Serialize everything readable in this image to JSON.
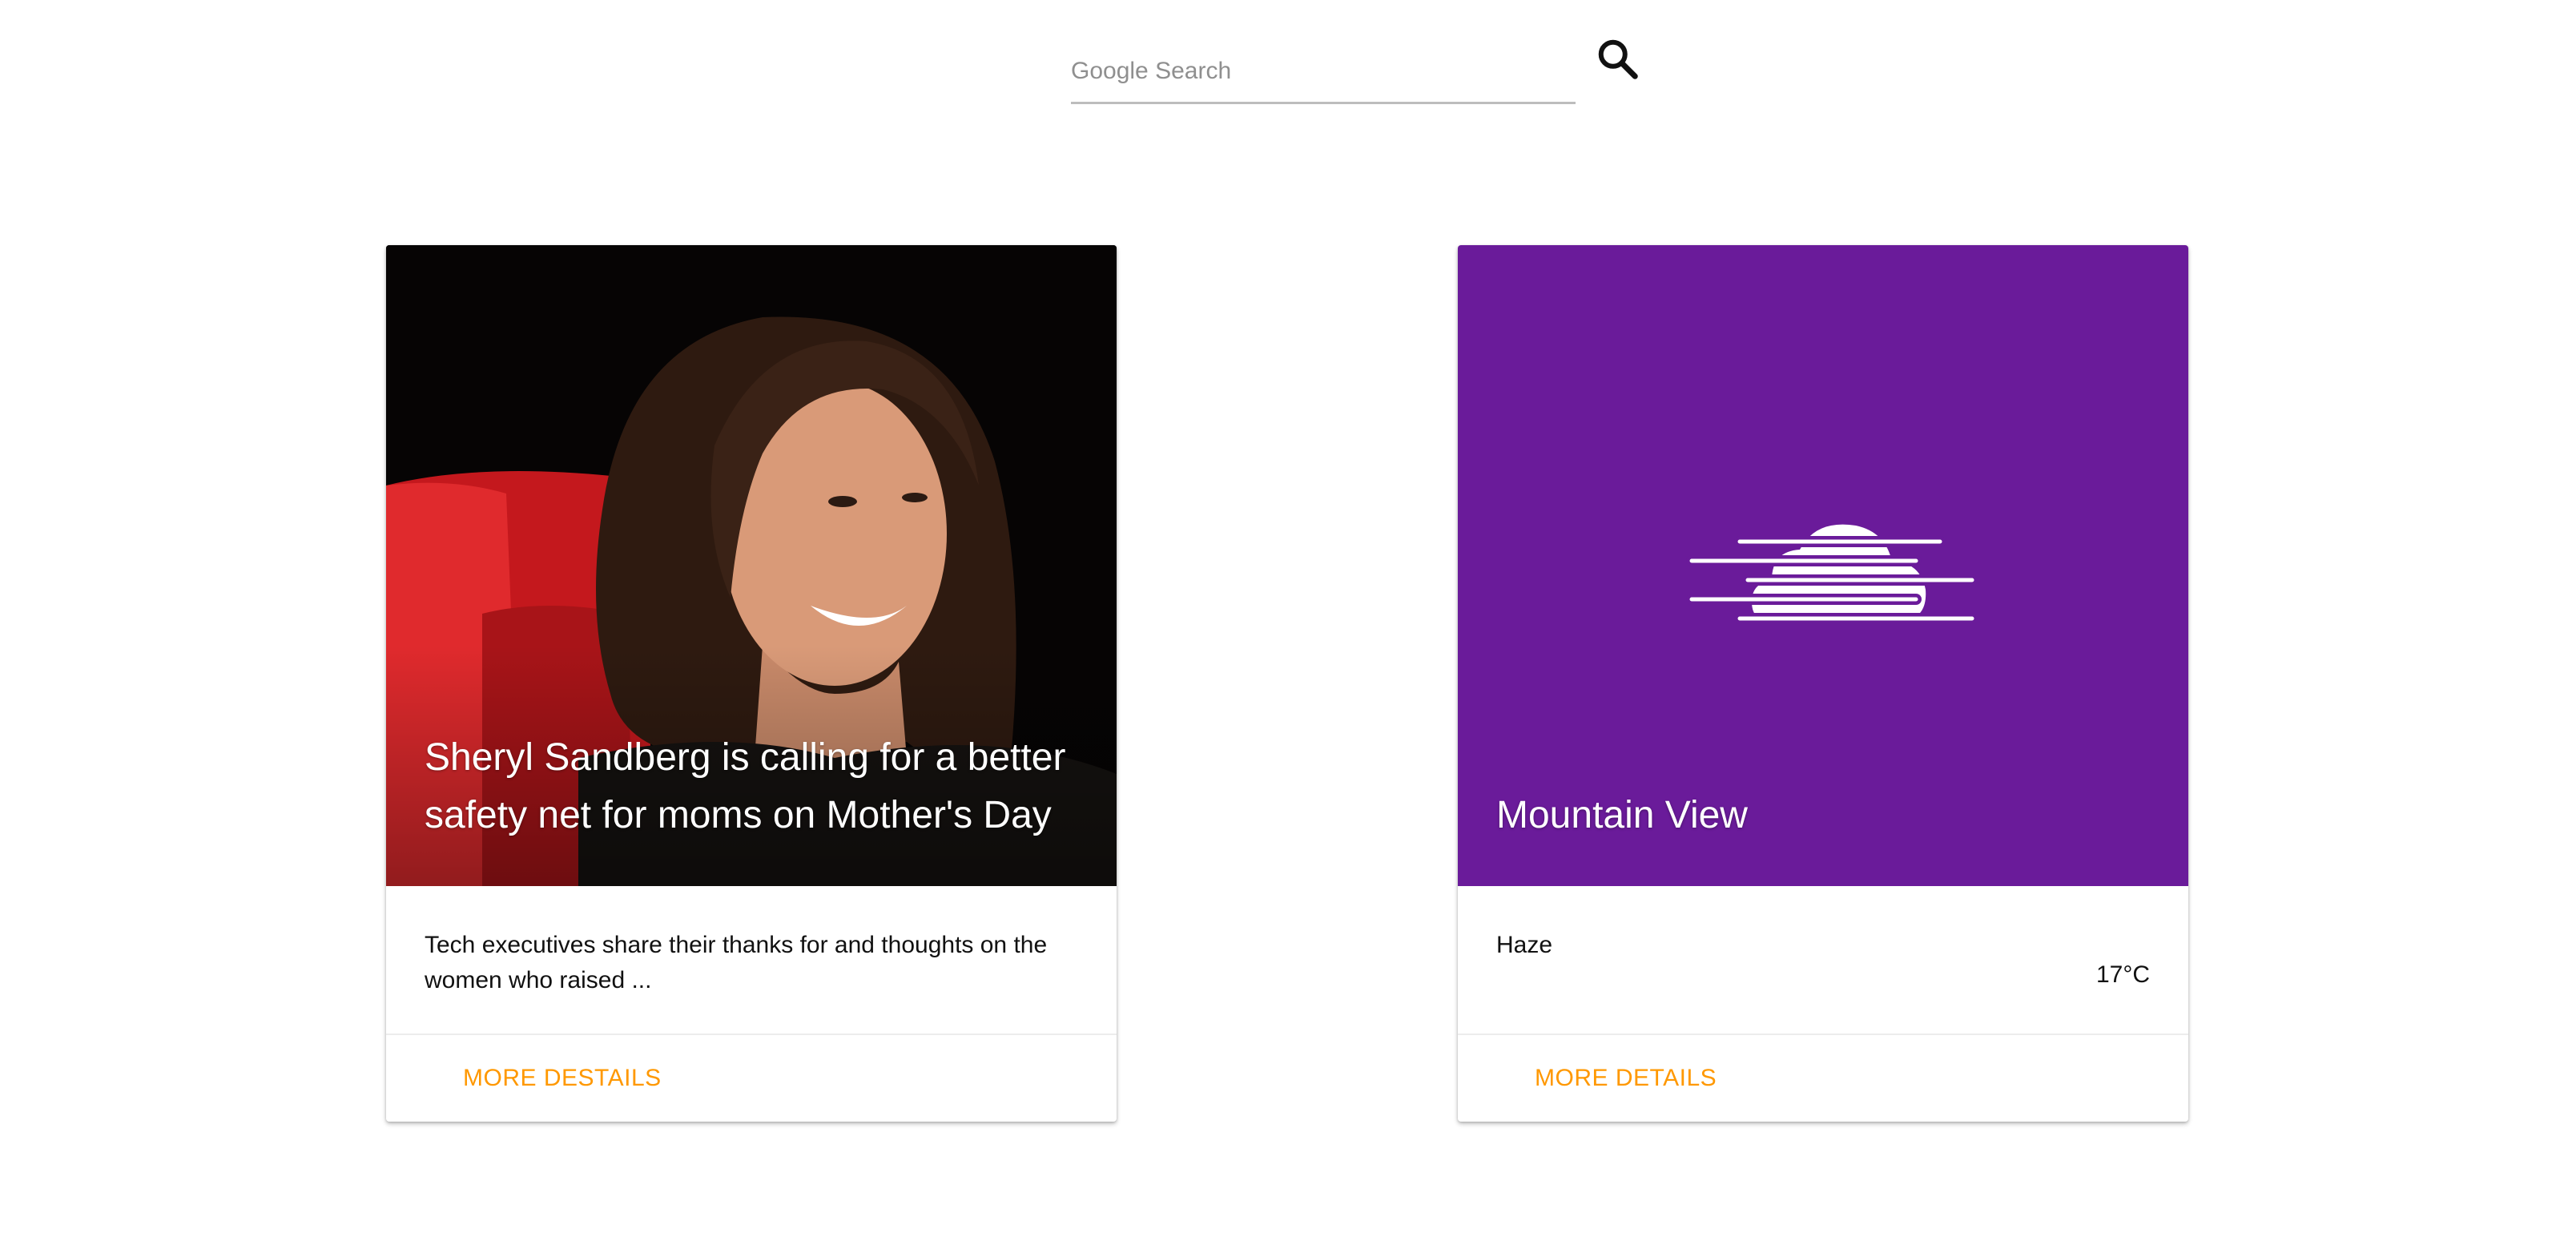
{
  "search": {
    "placeholder": "Google Search",
    "value": "",
    "icon": "search-icon"
  },
  "cards": {
    "news": {
      "title": "Sheryl Sandberg is calling for a better safety net for moms on Mother's Day",
      "description": "Tech executives share their thanks for and thoughts on the women who raised ...",
      "action_label": "MORE DESTAILS"
    },
    "weather": {
      "location": "Mountain View",
      "condition": "Haze",
      "temperature": "17°C",
      "icon": "haze-icon",
      "action_label": "MORE DETAILS"
    }
  },
  "colors": {
    "weather_background": "#6a1b9a",
    "action_text": "#ff9800",
    "search_underline": "#bdbdbd"
  }
}
